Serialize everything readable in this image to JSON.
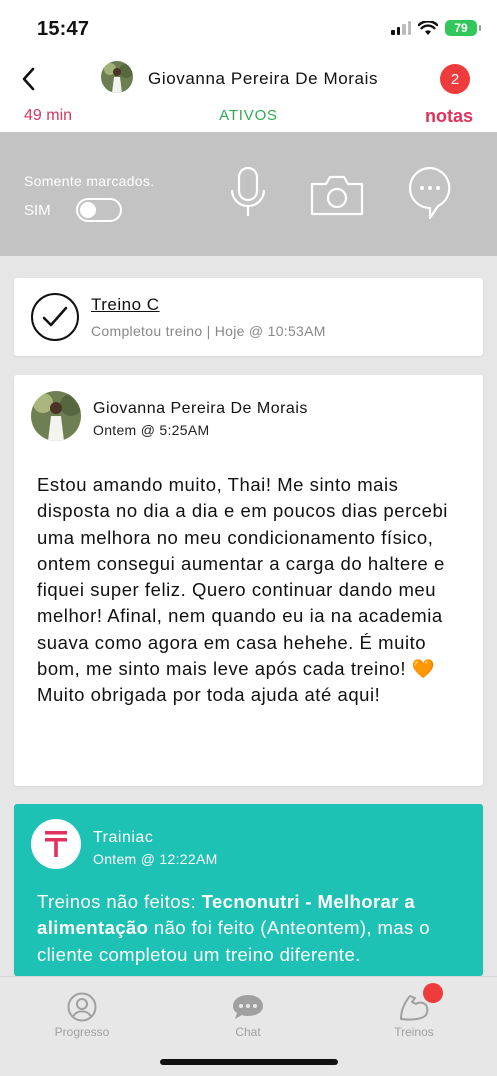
{
  "status_bar": {
    "time": "15:47",
    "battery": "79"
  },
  "header": {
    "name": "Giovanna Pereira De Morais",
    "badge": "2",
    "left_label": "49 min",
    "center_label": "ATIVOS",
    "right_label": "notas"
  },
  "filter": {
    "label": "Somente marcados.",
    "toggle_label": "SIM",
    "icons": [
      "microphone-icon",
      "camera-icon",
      "chat-bubble-icon"
    ]
  },
  "workout_card": {
    "title": "Treino C",
    "subtitle": "Completou treino | Hoje @ 10:53AM"
  },
  "message_card": {
    "author": "Giovanna Pereira De Morais",
    "time": "Ontem @ 5:25AM",
    "body": "Estou amando muito, Thai! Me sinto mais disposta no dia a dia e em poucos dias percebi uma melhora no meu condicionamento físico, ontem consegui aumentar a carga do haltere e fiquei super feliz. Quero continuar dando meu melhor! Afinal, nem quando eu ia na academia suava como agora em casa hehehe. É muito bom, me sinto mais leve após cada treino! 🧡 Muito obrigada por toda ajuda até aqui!"
  },
  "system_card": {
    "author": "Trainiac",
    "time": "Ontem @ 12:22AM",
    "body_prefix": "Treinos não feitos: ",
    "body_bold": "Tecnonutri - Melhorar a alimentação",
    "body_suffix": " não foi feito (Anteontem), mas o cliente completou um treino diferente."
  },
  "tabbar": {
    "tabs": [
      {
        "label": "Progresso",
        "icon": "profile-icon"
      },
      {
        "label": "Chat",
        "icon": "chat-icon"
      },
      {
        "label": "Treinos",
        "icon": "muscle-arm-icon"
      }
    ]
  },
  "colors": {
    "accent_red": "#e0325c",
    "active_green": "#31a855",
    "teal": "#1ec2b4",
    "filter_bg": "#c3c3c3"
  }
}
